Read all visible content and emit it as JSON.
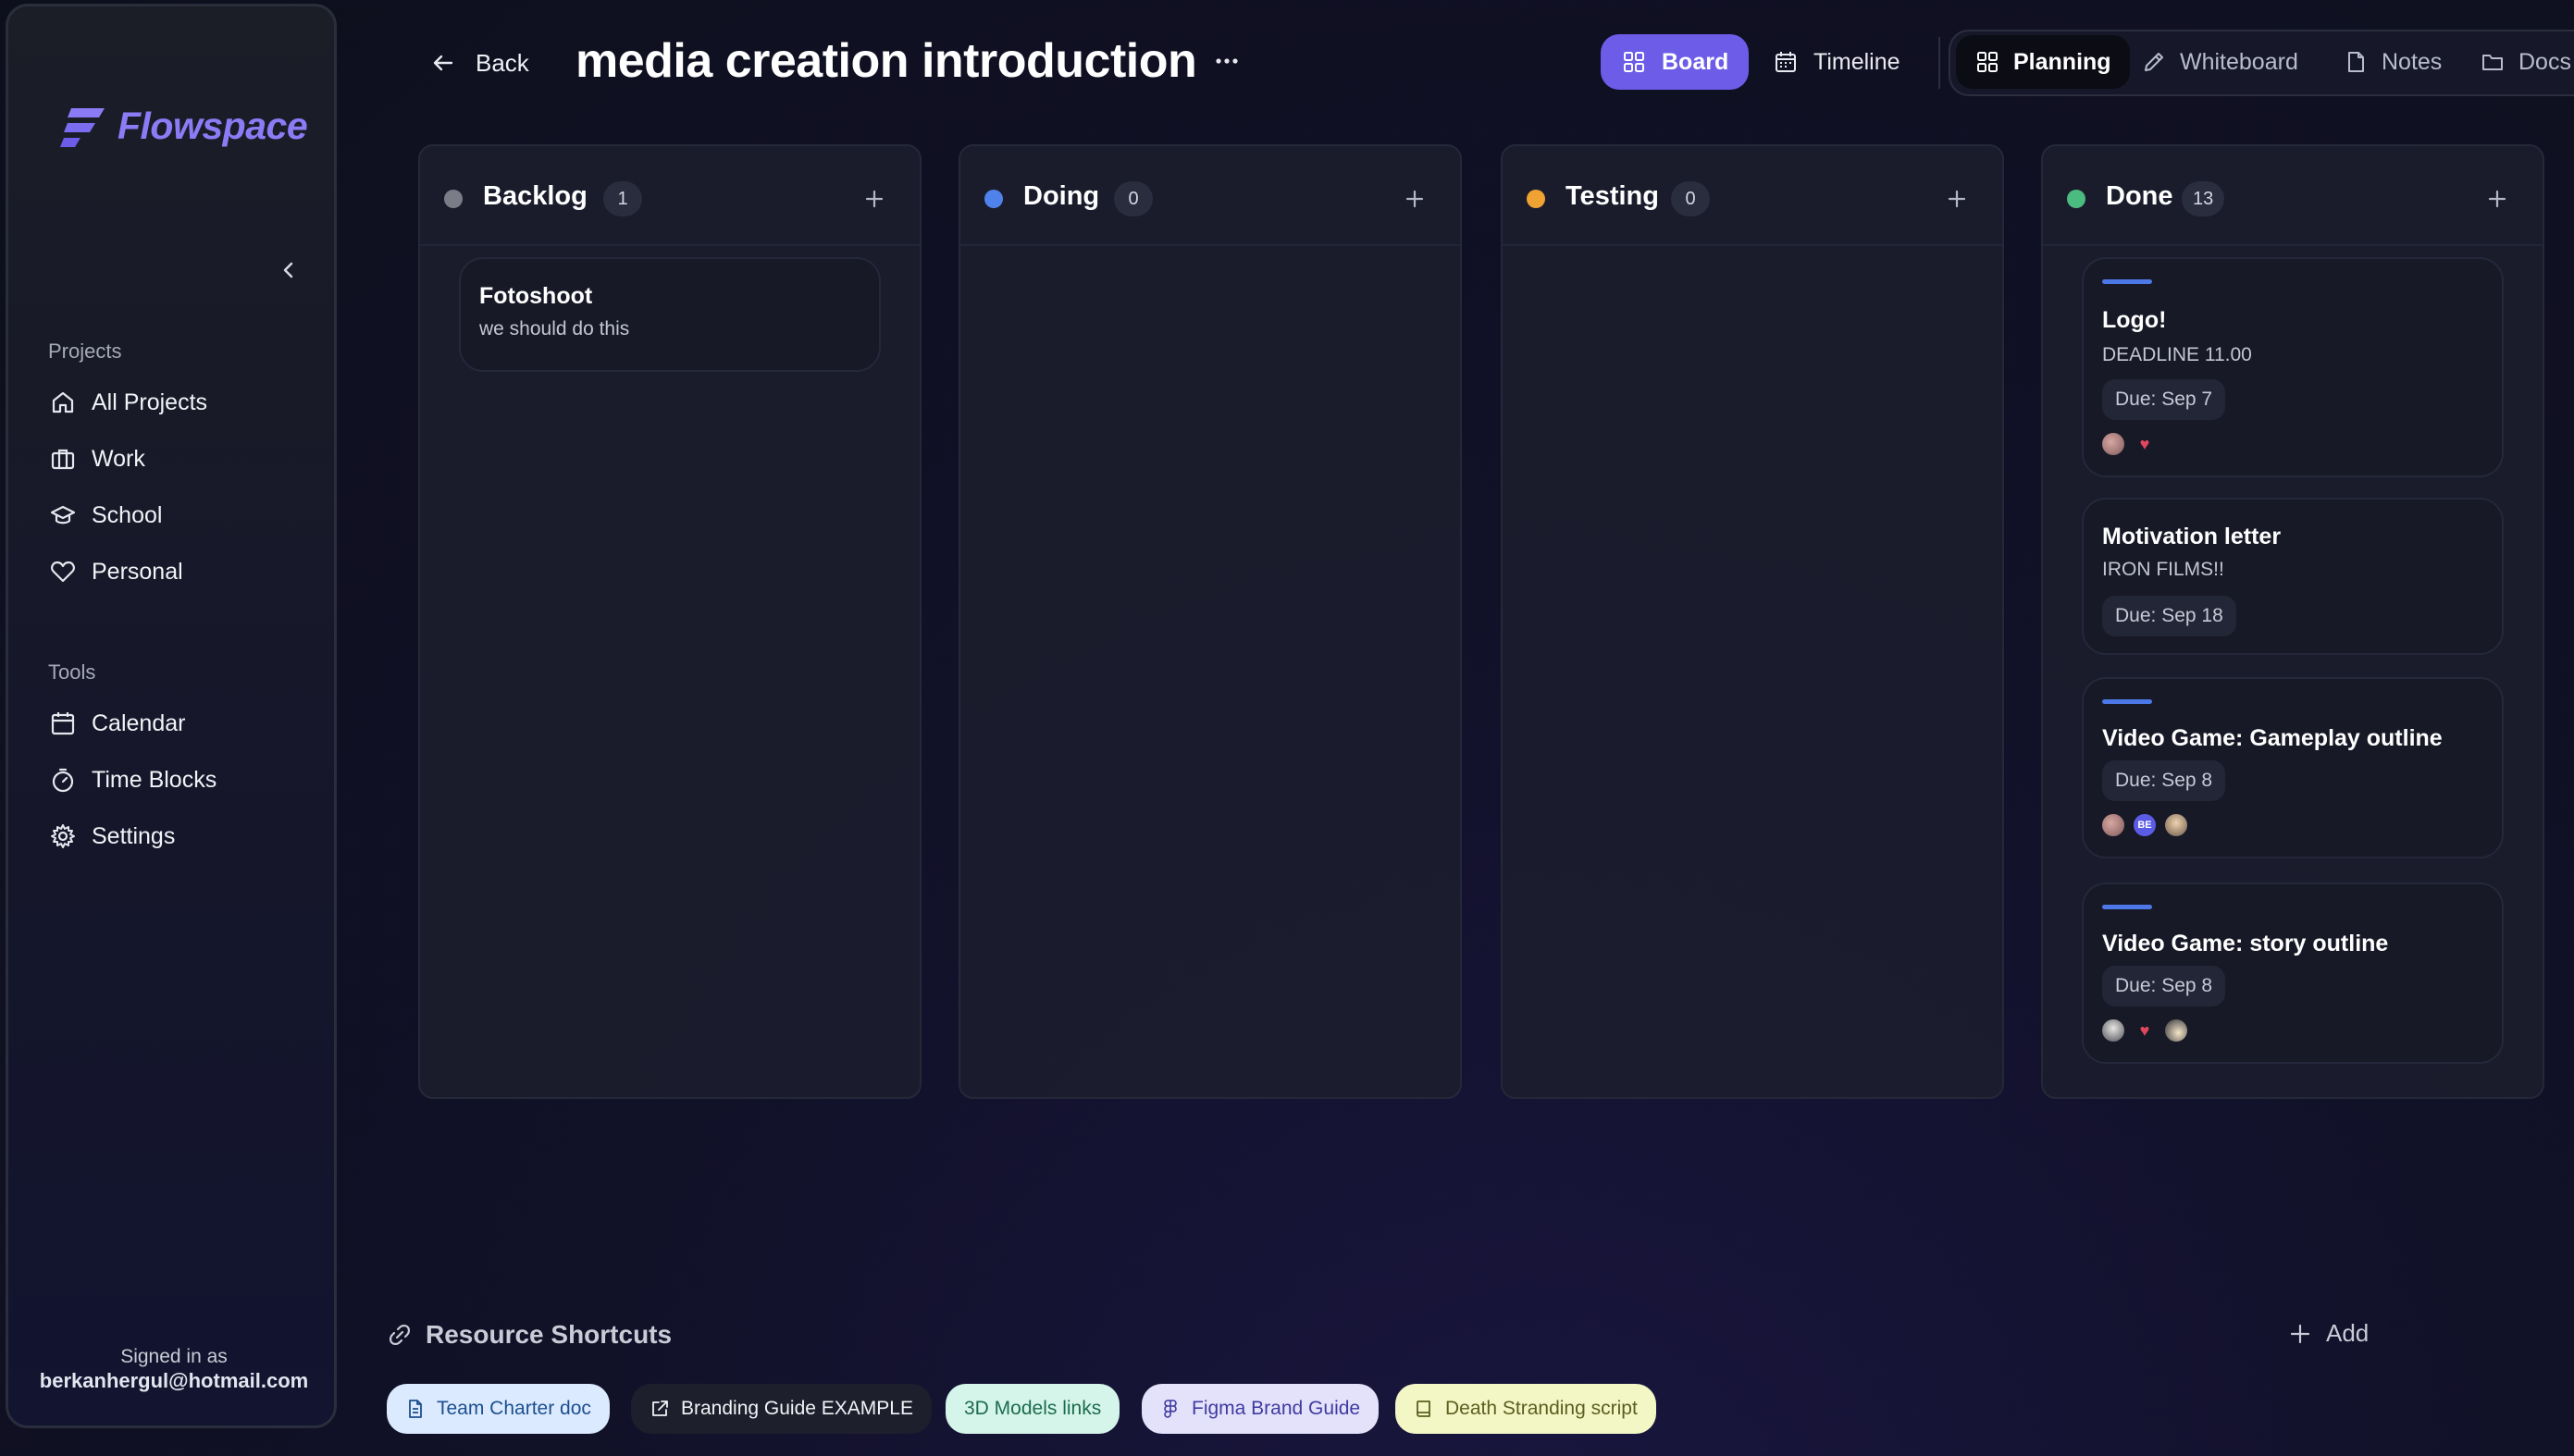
{
  "app": {
    "name": "Flowspace"
  },
  "sidebar": {
    "collapse_icon": "chevron-left-icon",
    "projects_title": "Projects",
    "projects": [
      {
        "label": "All Projects",
        "icon": "home-icon"
      },
      {
        "label": "Work",
        "icon": "briefcase-icon"
      },
      {
        "label": "School",
        "icon": "graduation-cap-icon"
      },
      {
        "label": "Personal",
        "icon": "heart-icon"
      }
    ],
    "tools_title": "Tools",
    "tools": [
      {
        "label": "Calendar",
        "icon": "calendar-icon"
      },
      {
        "label": "Time Blocks",
        "icon": "timer-icon"
      },
      {
        "label": "Settings",
        "icon": "gear-icon"
      }
    ],
    "signed_in_label": "Signed in as",
    "signed_in_email": "berkanhergul@hotmail.com"
  },
  "header": {
    "back_label": "Back",
    "title": "media creation introduction",
    "view_buttons": [
      {
        "label": "Board",
        "icon": "grid-icon",
        "active": true
      },
      {
        "label": "Timeline",
        "icon": "calendar-icon",
        "active": false
      }
    ],
    "tabs": [
      {
        "label": "Planning",
        "icon": "grid-icon",
        "active": true
      },
      {
        "label": "Whiteboard",
        "icon": "pencil-icon",
        "active": false
      },
      {
        "label": "Notes",
        "icon": "file-icon",
        "active": false
      },
      {
        "label": "Docs",
        "icon": "folder-icon",
        "active": false
      }
    ]
  },
  "board": {
    "columns": [
      {
        "title": "Backlog",
        "count": "1",
        "color": "#7a7d88",
        "cards": [
          {
            "title": "Fotoshoot",
            "description": "we should do this"
          }
        ]
      },
      {
        "title": "Doing",
        "count": "0",
        "color": "#4f82ea",
        "cards": []
      },
      {
        "title": "Testing",
        "count": "0",
        "color": "#f0a233",
        "cards": []
      },
      {
        "title": "Done",
        "count": "13",
        "color": "#4cbb7f",
        "cards": [
          {
            "title": "Logo!",
            "description": "DEADLINE 11.00",
            "due": "Due: Sep 7",
            "accent_bar": true,
            "avatars": [
              "photo-avatar",
              "heart-avatar"
            ]
          },
          {
            "title": "Motivation letter",
            "description": "IRON FILMS!!",
            "due": "Due: Sep 18",
            "accent_bar": false,
            "avatars": []
          },
          {
            "title": "Video Game: Gameplay outline",
            "due": "Due: Sep 8",
            "accent_bar": true,
            "avatars": [
              "photo-avatar",
              "initials-avatar",
              "photo-avatar"
            ]
          },
          {
            "title": "Video Game: story outline",
            "due": "Due: Sep 8",
            "accent_bar": true,
            "avatars": [
              "photo-avatar",
              "heart-avatar",
              "photo-avatar"
            ]
          }
        ]
      }
    ]
  },
  "resources": {
    "title": "Resource Shortcuts",
    "add_label": "Add",
    "shortcuts": [
      {
        "label": "Team Charter doc",
        "icon": "document-icon",
        "bg": "#dbeafe",
        "fg": "#1d4f8f"
      },
      {
        "label": "Branding Guide EXAMPLE",
        "icon": "external-link-icon",
        "bg": "#1d1f2c",
        "fg": "#f2f3f7"
      },
      {
        "label": "3D Models links",
        "icon": "",
        "bg": "#d5f5ea",
        "fg": "#1d6b4e"
      },
      {
        "label": "Figma Brand Guide",
        "icon": "figma-icon",
        "bg": "#e4e2fb",
        "fg": "#3f3aa0"
      },
      {
        "label": "Death Stranding script",
        "icon": "book-icon",
        "bg": "#f3f7c6",
        "fg": "#5b5f1e"
      }
    ]
  }
}
